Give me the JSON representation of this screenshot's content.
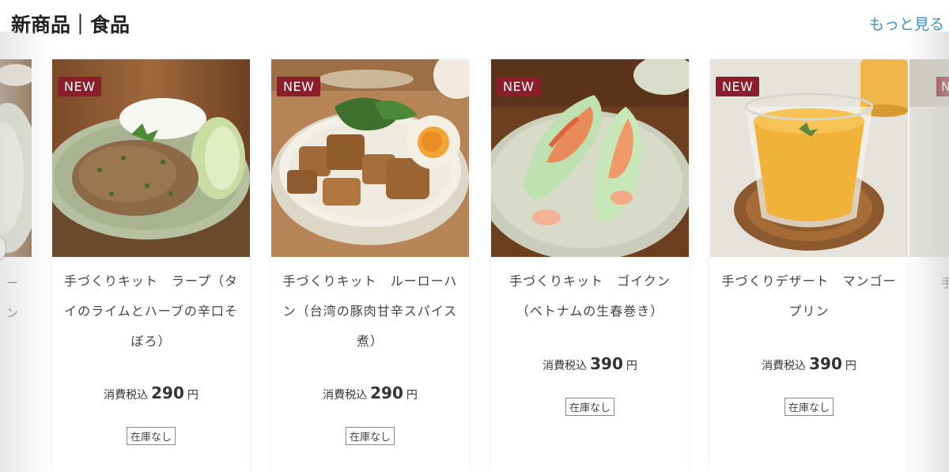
{
  "header": {
    "title": "新商品｜食品",
    "more_link": "もっと見る"
  },
  "left_partial": {
    "text_line1": "ー",
    "text_line2": "ン"
  },
  "right_partial": {
    "badge": "N",
    "text": "手"
  },
  "products": [
    {
      "badge": "NEW",
      "name": "手づくりキット　ラープ（タイのライムとハーブの辛口そぼろ）",
      "price_label": "消費税込",
      "price": "290",
      "currency": "円",
      "stock": "在庫なし",
      "image_icon": "larb-plate-photo"
    },
    {
      "badge": "NEW",
      "name": "手づくりキット　ルーローハン（台湾の豚肉甘辛スパイス煮）",
      "price_label": "消費税込",
      "price": "290",
      "currency": "円",
      "stock": "在庫なし",
      "image_icon": "luroufan-bowl-photo"
    },
    {
      "badge": "NEW",
      "name": "手づくりキット　ゴイクン（ベトナムの生春巻き）",
      "price_label": "消費税込",
      "price": "390",
      "currency": "円",
      "stock": "在庫なし",
      "image_icon": "spring-roll-photo"
    },
    {
      "badge": "NEW",
      "name": "手づくりデザート　マンゴープリン",
      "price_label": "消費税込",
      "price": "390",
      "currency": "円",
      "stock": "在庫なし",
      "image_icon": "mango-pudding-photo"
    }
  ]
}
